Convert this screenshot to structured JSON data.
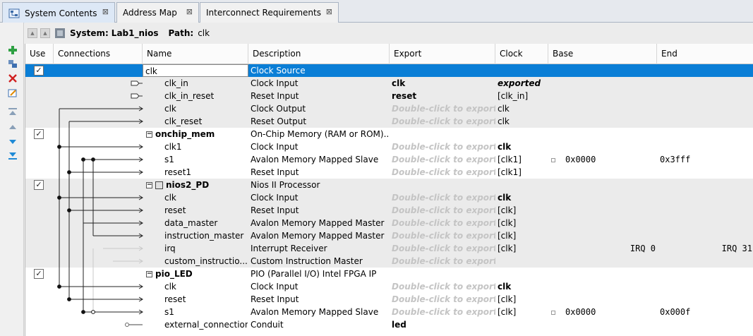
{
  "tabs": [
    {
      "label": "System Contents",
      "active": true
    },
    {
      "label": "Address Map",
      "active": false
    },
    {
      "label": "Interconnect Requirements",
      "active": false
    }
  ],
  "header": {
    "system_label": "System:",
    "system_value": "Lab1_nios",
    "path_label": "Path:",
    "path_value": "clk"
  },
  "columns": {
    "use": "Use",
    "connections": "Connections",
    "name": "Name",
    "description": "Description",
    "export": "Export",
    "clock": "Clock",
    "base": "Base",
    "end": "End"
  },
  "rows": [
    {
      "type": "module",
      "use": true,
      "name": "clk",
      "description": "Clock Source",
      "export": "",
      "clock": "",
      "base": "",
      "end": "",
      "selected": true
    },
    {
      "type": "port",
      "name": "clk_in",
      "description": "Clock Input",
      "export": "clk",
      "export_style": "bold",
      "clock": "exported",
      "clock_style": "bold-italic",
      "base": "",
      "end": ""
    },
    {
      "type": "port",
      "name": "clk_in_reset",
      "description": "Reset Input",
      "export": "reset",
      "export_style": "bold",
      "clock": "[clk_in]",
      "clock_style": "",
      "base": "",
      "end": ""
    },
    {
      "type": "port",
      "name": "clk",
      "description": "Clock Output",
      "export": "Double-click to export",
      "export_style": "hint",
      "clock": "clk",
      "clock_style": "",
      "base": "",
      "end": ""
    },
    {
      "type": "port",
      "name": "clk_reset",
      "description": "Reset Output",
      "export": "Double-click to export",
      "export_style": "hint",
      "clock": "clk",
      "clock_style": "",
      "base": "",
      "end": ""
    },
    {
      "type": "module",
      "use": true,
      "name": "onchip_mem",
      "description": "On-Chip Memory (RAM or ROM)...",
      "export": "",
      "clock": "",
      "base": "",
      "end": ""
    },
    {
      "type": "port",
      "name": "clk1",
      "description": "Clock Input",
      "export": "Double-click to export",
      "export_style": "hint",
      "clock": "clk",
      "clock_style": "bold",
      "base": "",
      "end": ""
    },
    {
      "type": "port",
      "name": "s1",
      "description": "Avalon Memory Mapped Slave",
      "export": "Double-click to export",
      "export_style": "hint",
      "clock": "[clk1]",
      "clock_style": "",
      "base": "0x0000",
      "base_lock": true,
      "end": "0x3fff"
    },
    {
      "type": "port",
      "name": "reset1",
      "description": "Reset Input",
      "export": "Double-click to export",
      "export_style": "hint",
      "clock": "[clk1]",
      "clock_style": "",
      "base": "",
      "end": ""
    },
    {
      "type": "module",
      "use": true,
      "cpu": true,
      "name": "nios2_PD",
      "description": "Nios II Processor",
      "export": "",
      "clock": "",
      "base": "",
      "end": ""
    },
    {
      "type": "port",
      "name": "clk",
      "description": "Clock Input",
      "export": "Double-click to export",
      "export_style": "hint",
      "clock": "clk",
      "clock_style": "bold",
      "base": "",
      "end": ""
    },
    {
      "type": "port",
      "name": "reset",
      "description": "Reset Input",
      "export": "Double-click to export",
      "export_style": "hint",
      "clock": "[clk]",
      "clock_style": "",
      "base": "",
      "end": ""
    },
    {
      "type": "port",
      "name": "data_master",
      "description": "Avalon Memory Mapped Master",
      "export": "Double-click to export",
      "export_style": "hint",
      "clock": "[clk]",
      "clock_style": "",
      "base": "",
      "end": ""
    },
    {
      "type": "port",
      "name": "instruction_master",
      "description": "Avalon Memory Mapped Master",
      "export": "Double-click to export",
      "export_style": "hint",
      "clock": "[clk]",
      "clock_style": "",
      "base": "",
      "end": ""
    },
    {
      "type": "port",
      "name": "irq",
      "description": "Interrupt Receiver",
      "export": "Double-click to export",
      "export_style": "hint",
      "clock": "[clk]",
      "clock_style": "",
      "base": "IRQ 0",
      "base_align": "right",
      "end": "IRQ 31",
      "end_align": "right"
    },
    {
      "type": "port",
      "name": "custom_instructio...",
      "description": "Custom Instruction Master",
      "export": "Double-click to export",
      "export_style": "hint",
      "clock": "",
      "clock_style": "",
      "base": "",
      "end": ""
    },
    {
      "type": "module",
      "use": true,
      "name": "pio_LED",
      "description": "PIO (Parallel I/O) Intel FPGA IP",
      "export": "",
      "clock": "",
      "base": "",
      "end": ""
    },
    {
      "type": "port",
      "name": "clk",
      "description": "Clock Input",
      "export": "Double-click to export",
      "export_style": "hint",
      "clock": "clk",
      "clock_style": "bold",
      "base": "",
      "end": ""
    },
    {
      "type": "port",
      "name": "reset",
      "description": "Reset Input",
      "export": "Double-click to export",
      "export_style": "hint",
      "clock": "[clk]",
      "clock_style": "",
      "base": "",
      "end": ""
    },
    {
      "type": "port",
      "name": "s1",
      "description": "Avalon Memory Mapped Slave",
      "export": "Double-click to export",
      "export_style": "hint",
      "clock": "[clk]",
      "clock_style": "",
      "base": "0x0000",
      "base_lock": true,
      "end": "0x000f"
    },
    {
      "type": "port",
      "name": "external_connection",
      "description": "Conduit",
      "export": "led",
      "export_style": "bold",
      "clock": "",
      "clock_style": "",
      "base": "",
      "end": ""
    }
  ],
  "toolbar_icons": [
    "add-component-icon",
    "add-connection-icon",
    "remove-icon",
    "edit-icon",
    "move-top-icon",
    "move-up-icon",
    "move-down-icon",
    "move-bottom-icon"
  ],
  "colors": {
    "selection": "#0a7ed6",
    "group_shade": "#ebebeb",
    "hint_text": "#c4c4c4"
  }
}
